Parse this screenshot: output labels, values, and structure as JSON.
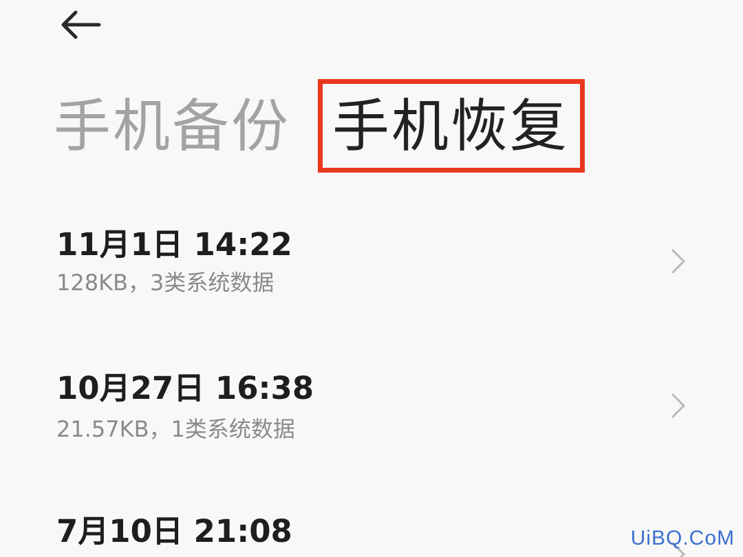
{
  "header": {
    "back_icon": "arrow-left-icon"
  },
  "tabs": {
    "backup_label": "手机备份",
    "restore_label": "手机恢复",
    "highlight_color": "#e8391f"
  },
  "backups": [
    {
      "title": "11月1日 14:22",
      "detail": "128KB，3类系统数据"
    },
    {
      "title": "10月27日 16:38",
      "detail": "21.57KB，1类系统数据"
    },
    {
      "title": "7月10日 21:08",
      "detail": ""
    }
  ],
  "watermark": "UiBQ.CoM"
}
